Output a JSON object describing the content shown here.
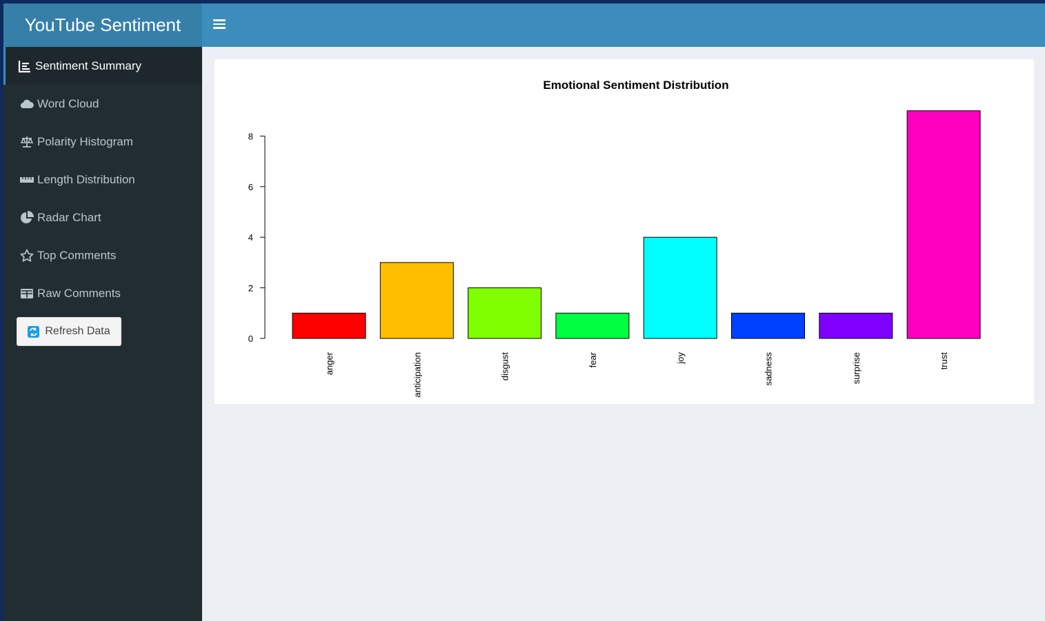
{
  "app": {
    "title": "YouTube Sentiment"
  },
  "sidebar": {
    "items": [
      {
        "label": "Sentiment Summary",
        "icon": "bar-chart-icon",
        "active": true
      },
      {
        "label": "Word Cloud",
        "icon": "cloud-icon"
      },
      {
        "label": "Polarity Histogram",
        "icon": "balance-scale-icon"
      },
      {
        "label": "Length Distribution",
        "icon": "ruler-icon"
      },
      {
        "label": "Radar Chart",
        "icon": "pie-chart-icon"
      },
      {
        "label": "Top Comments",
        "icon": "star-icon"
      },
      {
        "label": "Raw Comments",
        "icon": "table-icon"
      }
    ],
    "refresh_label": "Refresh Data",
    "refresh_icon": "refresh-icon"
  },
  "colors": {
    "header": "#3c8dbc",
    "logo": "#367fa9",
    "sidebar": "#222d32",
    "content_bg": "#ecf0f5"
  },
  "chart_data": {
    "type": "bar",
    "title": "Emotional Sentiment Distribution",
    "categories": [
      "anger",
      "anticipation",
      "disgust",
      "fear",
      "joy",
      "sadness",
      "surprise",
      "trust"
    ],
    "values": [
      1,
      3,
      2,
      1,
      4,
      1,
      1,
      9
    ],
    "colors": [
      "#ff0000",
      "#ffbf00",
      "#80ff00",
      "#00ff40",
      "#00ffff",
      "#0040ff",
      "#8000ff",
      "#ff00bf"
    ],
    "yticks": [
      "0",
      "2",
      "4",
      "6",
      "8"
    ],
    "ylim": [
      0,
      9
    ],
    "xlabel": "",
    "ylabel": "",
    "grid": false
  }
}
